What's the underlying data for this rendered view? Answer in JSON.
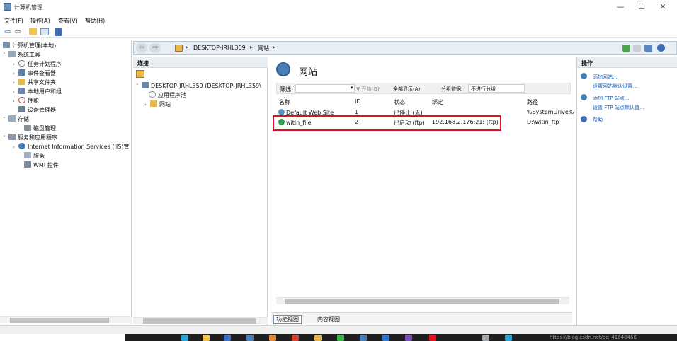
{
  "window": {
    "title": "计算机管理",
    "controls": {
      "minimize": "—",
      "maximize": "☐",
      "close": "✕"
    }
  },
  "menu": [
    "文件(F)",
    "操作(A)",
    "查看(V)",
    "帮助(H)"
  ],
  "toolbar": {
    "back": "⇦",
    "forward": "⇨"
  },
  "tree": [
    {
      "label": "计算机管理(本地)",
      "chev": ""
    },
    {
      "label": "系统工具",
      "chev": "˅"
    },
    {
      "label": "任务计划程序",
      "chev": "›"
    },
    {
      "label": "事件查看器",
      "chev": "›"
    },
    {
      "label": "共享文件夹",
      "chev": "›"
    },
    {
      "label": "本地用户和组",
      "chev": "›"
    },
    {
      "label": "性能",
      "chev": "›"
    },
    {
      "label": "设备管理器",
      "chev": ""
    },
    {
      "label": "存储",
      "chev": "˅"
    },
    {
      "label": "磁盘管理",
      "chev": ""
    },
    {
      "label": "服务和应用程序",
      "chev": "˅"
    },
    {
      "label": "Internet Information Services (IIS)管",
      "chev": "›"
    },
    {
      "label": "服务",
      "chev": ""
    },
    {
      "label": "WMI 控件",
      "chev": ""
    }
  ],
  "address": {
    "segments": [
      "DESKTOP-JRHL359",
      "网站"
    ],
    "separator": "▸"
  },
  "connections": {
    "header": "连接",
    "server": "DESKTOP-JRHL359 (DESKTOP-JRHL359\\",
    "app_pools": "应用程序池",
    "sites": "网站"
  },
  "center": {
    "title": "网站",
    "filter": {
      "label": "筛选:",
      "go": "▼ 开始(G)",
      "show_all": "全部显示(A)",
      "group_by_label": "分组依据:",
      "group_by_value": "不进行分组"
    },
    "columns": [
      "名称",
      "ID",
      "状态",
      "绑定",
      "路径"
    ],
    "rows": [
      {
        "name": "Default Web Site",
        "id": "1",
        "status": "已停止 (无)",
        "binding": "",
        "path": "%SystemDrive%"
      },
      {
        "name": "witin_file",
        "id": "2",
        "status": "已启动 (ftp)",
        "binding": "192.168.2.176:21: (ftp)",
        "path": "D:\\witin_ftp"
      }
    ],
    "tabs": [
      "功能视图",
      "内容视图"
    ]
  },
  "actions": {
    "header": "操作",
    "items": [
      "添加网站...",
      "设置网站默认设置...",
      "添加 FTP 站点...",
      "设置 FTP 站点默认值...",
      "帮助"
    ]
  },
  "taskbar": {
    "watermark": "https://blog.csdn.net/qq_41848466"
  },
  "colors": {
    "highlight": "#e3101f",
    "link": "#1a5fb4"
  }
}
